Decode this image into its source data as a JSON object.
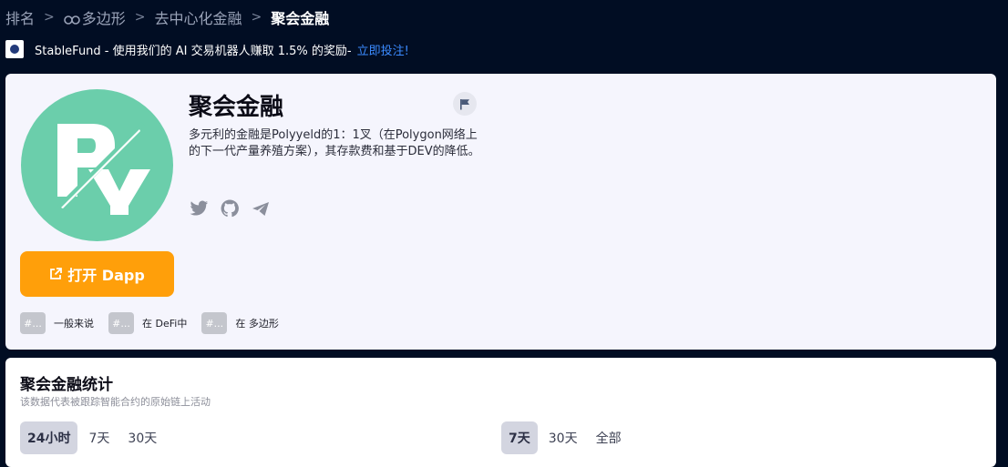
{
  "breadcrumb": {
    "items": [
      "排名",
      "多边形",
      "去中心化金融"
    ],
    "current": "聚会金融"
  },
  "promo": {
    "text": "StableFund - 使用我们的 AI 交易机器人赚取 1.5% 的奖励-",
    "link": "立即投注!"
  },
  "project": {
    "name": "聚会金融",
    "description": "多元利的金融是Polyyeld的1：1叉（在Polygon网络上的下一代产量养殖方案），其存款费和基于DEV的降低。",
    "open_button": "打开 Dapp",
    "logo_color": "#6bceab",
    "socials": [
      "twitter-icon",
      "github-icon",
      "telegram-icon"
    ]
  },
  "tags": [
    {
      "hash": "#...",
      "label": "一般来说"
    },
    {
      "hash": "#...",
      "label": "在 DeFi中"
    },
    {
      "hash": "#...",
      "label": "在 多边形"
    }
  ],
  "stats": {
    "title": "聚会金融统计",
    "subtitle": "该数据代表被跟踪智能合约的原始链上活动",
    "left_tabs": [
      {
        "label": "24小时",
        "active": true
      },
      {
        "label": "7天",
        "active": false
      },
      {
        "label": "30天",
        "active": false
      }
    ],
    "right_tabs": [
      {
        "label": "7天",
        "active": true
      },
      {
        "label": "30天",
        "active": false
      },
      {
        "label": "全部",
        "active": false
      }
    ]
  },
  "colors": {
    "background": "#010d23",
    "accent_orange": "#ff9f0a",
    "link_blue": "#3b8bff"
  }
}
